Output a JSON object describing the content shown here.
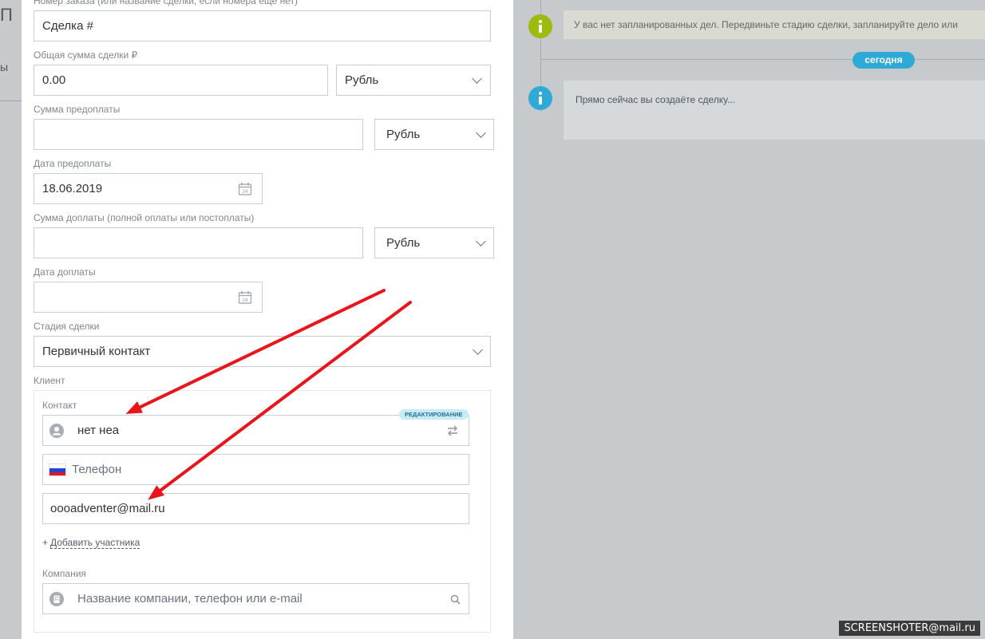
{
  "left_strip": {
    "fragment": "П",
    "fragment2": "ы"
  },
  "form": {
    "order_number": {
      "label": "Номер заказа (или название сделки, если номера еще нет)",
      "value": "Сделка #"
    },
    "total": {
      "label": "Общая сумма сделки ₽",
      "value": "0.00",
      "currency": "Рубль"
    },
    "prepay_sum": {
      "label": "Сумма предоплаты",
      "value": "",
      "currency": "Рубль"
    },
    "prepay_date": {
      "label": "Дата предоплаты",
      "value": "18.06.2019",
      "cal_num": "24"
    },
    "extra_sum": {
      "label": "Сумма доплаты (полной оплаты или постоплаты)",
      "value": "",
      "currency": "Рубль"
    },
    "extra_date": {
      "label": "Дата доплаты",
      "value": "",
      "cal_num": "24"
    },
    "stage": {
      "label": "Стадия сделки",
      "value": "Первичный контакт"
    },
    "client": {
      "label": "Клиент",
      "contact_label": "Контакт",
      "edit_badge": "РЕДАКТИРОВАНИЕ",
      "contact_name": "нет неа",
      "phone_placeholder": "Телефон",
      "email": "oooadventer@mail.ru",
      "add_participant": "Добавить участника",
      "add_plus": "+",
      "company_label": "Компания",
      "company_placeholder": "Название компании, телефон или e-mail"
    }
  },
  "timeline": {
    "notice1": "У вас нет запланированных дел. Передвиньте стадию сделки, запланируйте дело или",
    "today": "сегодня",
    "notice2": "Прямо сейчас вы создаёте сделку..."
  },
  "watermark": "SCREENSHOTER@mail.ru",
  "colors": {
    "badge_green": "#9dba0e",
    "badge_blue": "#2fc6f6",
    "today_pill": "#2fa9d6",
    "arrow": "#e8161c",
    "edit_badge_bg": "#c5ecf9"
  },
  "icons": [
    "calendar-icon",
    "chevron-down-icon",
    "user-icon",
    "swap-icon",
    "flag-ru-icon",
    "company-icon",
    "search-icon",
    "info-icon",
    "arrow-annotation"
  ]
}
